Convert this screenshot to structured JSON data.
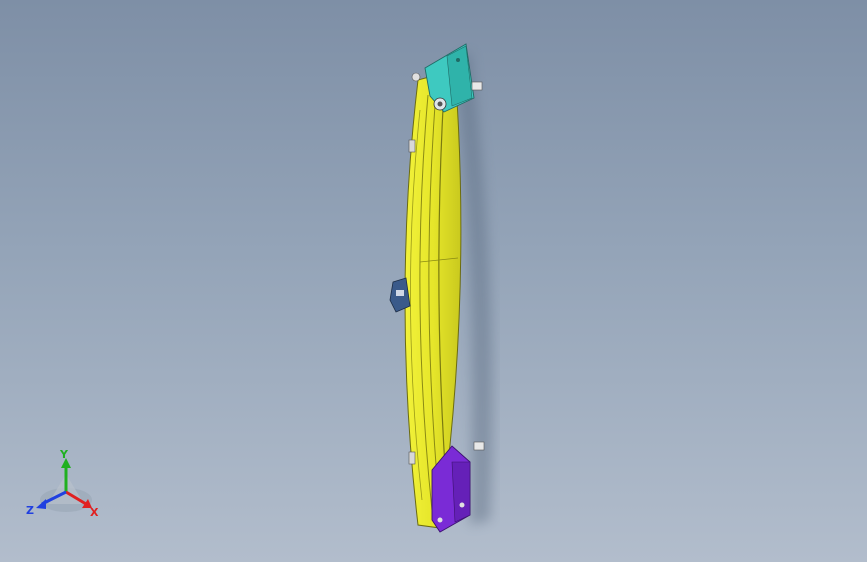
{
  "viewport": {
    "background_top": "#7e8fa6",
    "background_bottom": "#b2bdcc"
  },
  "model": {
    "part_colors": {
      "rail": "#e6e62a",
      "rail_shadow": "#b9b918",
      "top_bracket": "#3ec9c0",
      "bottom_bracket": "#7a2bd6",
      "clip": "#3a5a8a"
    }
  },
  "triad": {
    "x_label": "X",
    "y_label": "Y",
    "z_label": "Z",
    "x_color": "#e02020",
    "y_color": "#20b020",
    "z_color": "#2040e0"
  }
}
